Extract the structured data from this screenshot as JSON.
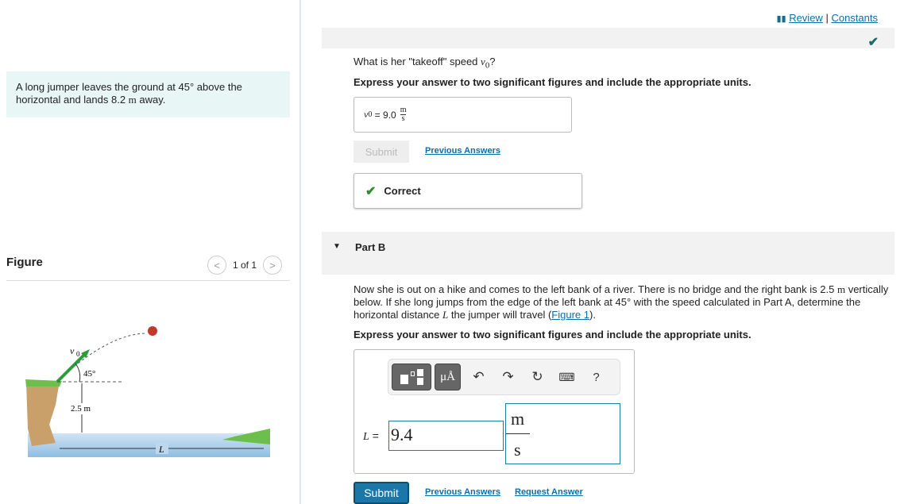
{
  "problem": {
    "text_pre": "A long jumper leaves the ground at 45",
    "deg": "°",
    "text_mid": " above the horizontal and lands 8.2 ",
    "unit": "m",
    "text_post": " away."
  },
  "figure": {
    "heading": "Figure",
    "pager": "1 of 1",
    "labels": {
      "v0": "v",
      "v0_sub": "0",
      "angle": "45°",
      "height": "2.5 m",
      "L": "L"
    }
  },
  "header": {
    "review": "Review",
    "sep": "|",
    "constants": "Constants"
  },
  "part_a": {
    "question": "What is her \"takeoff\" speed ",
    "var": "v",
    "var_sub": "0",
    "q_end": "?",
    "instruction": "Express your answer to two significant figures and include the appropriate units.",
    "answer_lhs": "v",
    "answer_sub": "0",
    "answer_eq": " = ",
    "answer_value": "9.0",
    "unit_num": "m",
    "unit_den": "s",
    "submit": "Submit",
    "previous_answers": "Previous Answers",
    "feedback": "Correct"
  },
  "part_b": {
    "title": "Part B",
    "text1": "Now she is out on a hike and comes to the left bank of a river. There is no bridge and the right bank is 2.5 ",
    "unit_m": "m",
    "text2": " vertically below. If she long jumps from the edge of the left bank at 45° with the speed calculated in Part A, determine the horizontal distance ",
    "var": "L",
    "text3": " the jumper will travel (",
    "fig_link": "Figure 1",
    "text4": ").",
    "instruction": "Express your answer to two significant figures and include the appropriate units.",
    "lhs": "L",
    "eq": "=",
    "value": "9.4",
    "unit_num": "m",
    "unit_den": "s",
    "toolbar": {
      "units_btn": "μÅ",
      "help": "?"
    },
    "submit": "Submit",
    "previous_answers": "Previous Answers",
    "request_answer": "Request Answer"
  },
  "colors": {
    "accent": "#1a77a8",
    "correct": "#1a6b6b",
    "problem_bg": "#e8f6f6"
  }
}
